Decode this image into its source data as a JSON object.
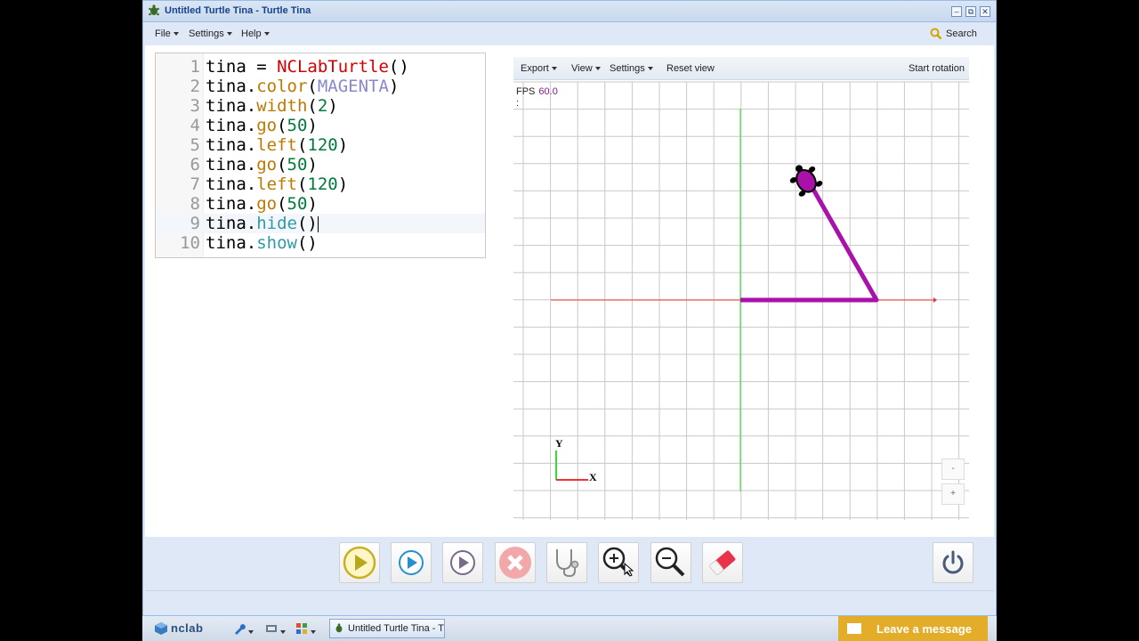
{
  "window": {
    "title": "Untitled Turtle Tina - Turtle Tina",
    "minimize": "–",
    "restore": "⧉",
    "close": "✕"
  },
  "menu": {
    "file": "File",
    "settings": "Settings",
    "help": "Help",
    "search": "Search"
  },
  "editor": {
    "lines": [
      {
        "n": "1",
        "tokens": [
          [
            "",
            "tina = "
          ],
          [
            "cls",
            "NCLabTurtle"
          ],
          [
            "",
            "()"
          ]
        ]
      },
      {
        "n": "2",
        "tokens": [
          [
            "",
            "tina."
          ],
          [
            "fn",
            "color"
          ],
          [
            "",
            "("
          ],
          [
            "const",
            "MAGENTA"
          ],
          [
            "",
            ")"
          ]
        ]
      },
      {
        "n": "3",
        "tokens": [
          [
            "",
            "tina."
          ],
          [
            "fn",
            "width"
          ],
          [
            "",
            "("
          ],
          [
            "num",
            "2"
          ],
          [
            "",
            ")"
          ]
        ]
      },
      {
        "n": "4",
        "tokens": [
          [
            "",
            "tina."
          ],
          [
            "fn",
            "go"
          ],
          [
            "",
            "("
          ],
          [
            "num",
            "50"
          ],
          [
            "",
            ")"
          ]
        ]
      },
      {
        "n": "5",
        "tokens": [
          [
            "",
            "tina."
          ],
          [
            "fn",
            "left"
          ],
          [
            "",
            "("
          ],
          [
            "num",
            "120"
          ],
          [
            "",
            ")"
          ]
        ]
      },
      {
        "n": "6",
        "tokens": [
          [
            "",
            "tina."
          ],
          [
            "fn",
            "go"
          ],
          [
            "",
            "("
          ],
          [
            "num",
            "50"
          ],
          [
            "",
            ")"
          ]
        ]
      },
      {
        "n": "7",
        "tokens": [
          [
            "",
            "tina."
          ],
          [
            "fn",
            "left"
          ],
          [
            "",
            "("
          ],
          [
            "num",
            "120"
          ],
          [
            "",
            ")"
          ]
        ]
      },
      {
        "n": "8",
        "tokens": [
          [
            "",
            "tina."
          ],
          [
            "fn",
            "go"
          ],
          [
            "",
            "("
          ],
          [
            "num",
            "50"
          ],
          [
            "",
            ")"
          ]
        ]
      },
      {
        "n": "9",
        "tokens": [
          [
            "",
            "tina."
          ],
          [
            "fn2",
            "hide"
          ],
          [
            "",
            "()"
          ]
        ]
      },
      {
        "n": "10",
        "tokens": [
          [
            "",
            "tina."
          ],
          [
            "fn2",
            "show"
          ],
          [
            "",
            "()"
          ]
        ]
      }
    ],
    "active_line": 9
  },
  "viewer": {
    "export": "Export",
    "view": "View",
    "settings": "Settings",
    "reset_view": "Reset view",
    "start_rotation": "Start rotation",
    "fps_label": "FPS",
    "fps_value": "60.0",
    "fps_colon": ":",
    "axis_x": "X",
    "axis_y": "Y",
    "zoom_out": "-",
    "zoom_in": "+",
    "pen_color": "#aa10aa",
    "x_axis_color": "#ee3333",
    "y_axis_color": "#33dd33",
    "turtle_color": "#aa10aa"
  },
  "tools": {
    "run": "run-icon",
    "step": "step-icon",
    "play_slow": "play-slow-icon",
    "stop": "stop-icon",
    "debug": "stethoscope-icon",
    "zoom_in": "zoom-in-icon",
    "zoom_out": "zoom-out-icon",
    "erase": "eraser-icon",
    "power": "power-icon"
  },
  "taskbar": {
    "logo": "nclab",
    "task_label": "Untitled Turtle Tina - Tu",
    "leave_message": "Leave a message"
  }
}
